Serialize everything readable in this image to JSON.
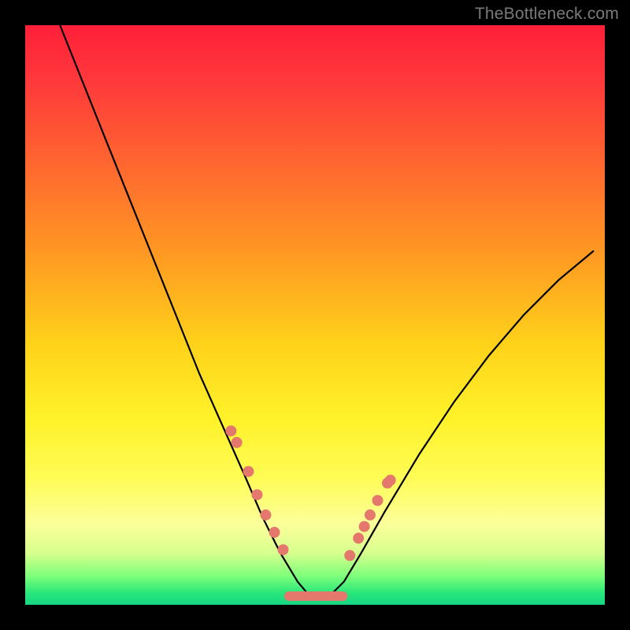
{
  "watermark": "TheBottleneck.com",
  "chart_data": {
    "type": "line",
    "title": "",
    "xlabel": "",
    "ylabel": "",
    "xlim": [
      0,
      1
    ],
    "ylim": [
      0,
      1
    ],
    "background_gradient": {
      "direction": "vertical",
      "mapped_to": "y",
      "colors": [
        "#ff1f3a",
        "#ffd21a",
        "#fffc55",
        "#17d585"
      ],
      "meaning": "top=high(bad) bottom=low(good)"
    },
    "series": [
      {
        "name": "bottleneck-curve",
        "stroke": "#000000",
        "x": [
          0.06,
          0.1,
          0.14,
          0.18,
          0.22,
          0.26,
          0.3,
          0.34,
          0.38,
          0.41,
          0.44,
          0.47,
          0.495,
          0.52,
          0.55,
          0.58,
          0.62,
          0.68,
          0.74,
          0.8,
          0.86,
          0.92,
          0.98
        ],
        "values": [
          1.0,
          0.9,
          0.8,
          0.7,
          0.6,
          0.5,
          0.4,
          0.31,
          0.22,
          0.15,
          0.09,
          0.04,
          0.01,
          0.01,
          0.04,
          0.09,
          0.16,
          0.26,
          0.35,
          0.43,
          0.5,
          0.56,
          0.61
        ]
      }
    ],
    "annotated_points": {
      "description": "salmon dots on curve near bottom region",
      "color": "#e5786d",
      "x": [
        0.355,
        0.365,
        0.385,
        0.4,
        0.415,
        0.43,
        0.445,
        0.56,
        0.575,
        0.585,
        0.595,
        0.608,
        0.625,
        0.63
      ],
      "values": [
        0.3,
        0.28,
        0.23,
        0.19,
        0.155,
        0.125,
        0.095,
        0.085,
        0.115,
        0.135,
        0.155,
        0.18,
        0.21,
        0.215
      ]
    },
    "flat_minimum_segment": {
      "description": "salmon horizontal bar at basin of curve",
      "color": "#e5786d",
      "x_start": 0.455,
      "x_end": 0.548,
      "value": 0.015
    }
  }
}
